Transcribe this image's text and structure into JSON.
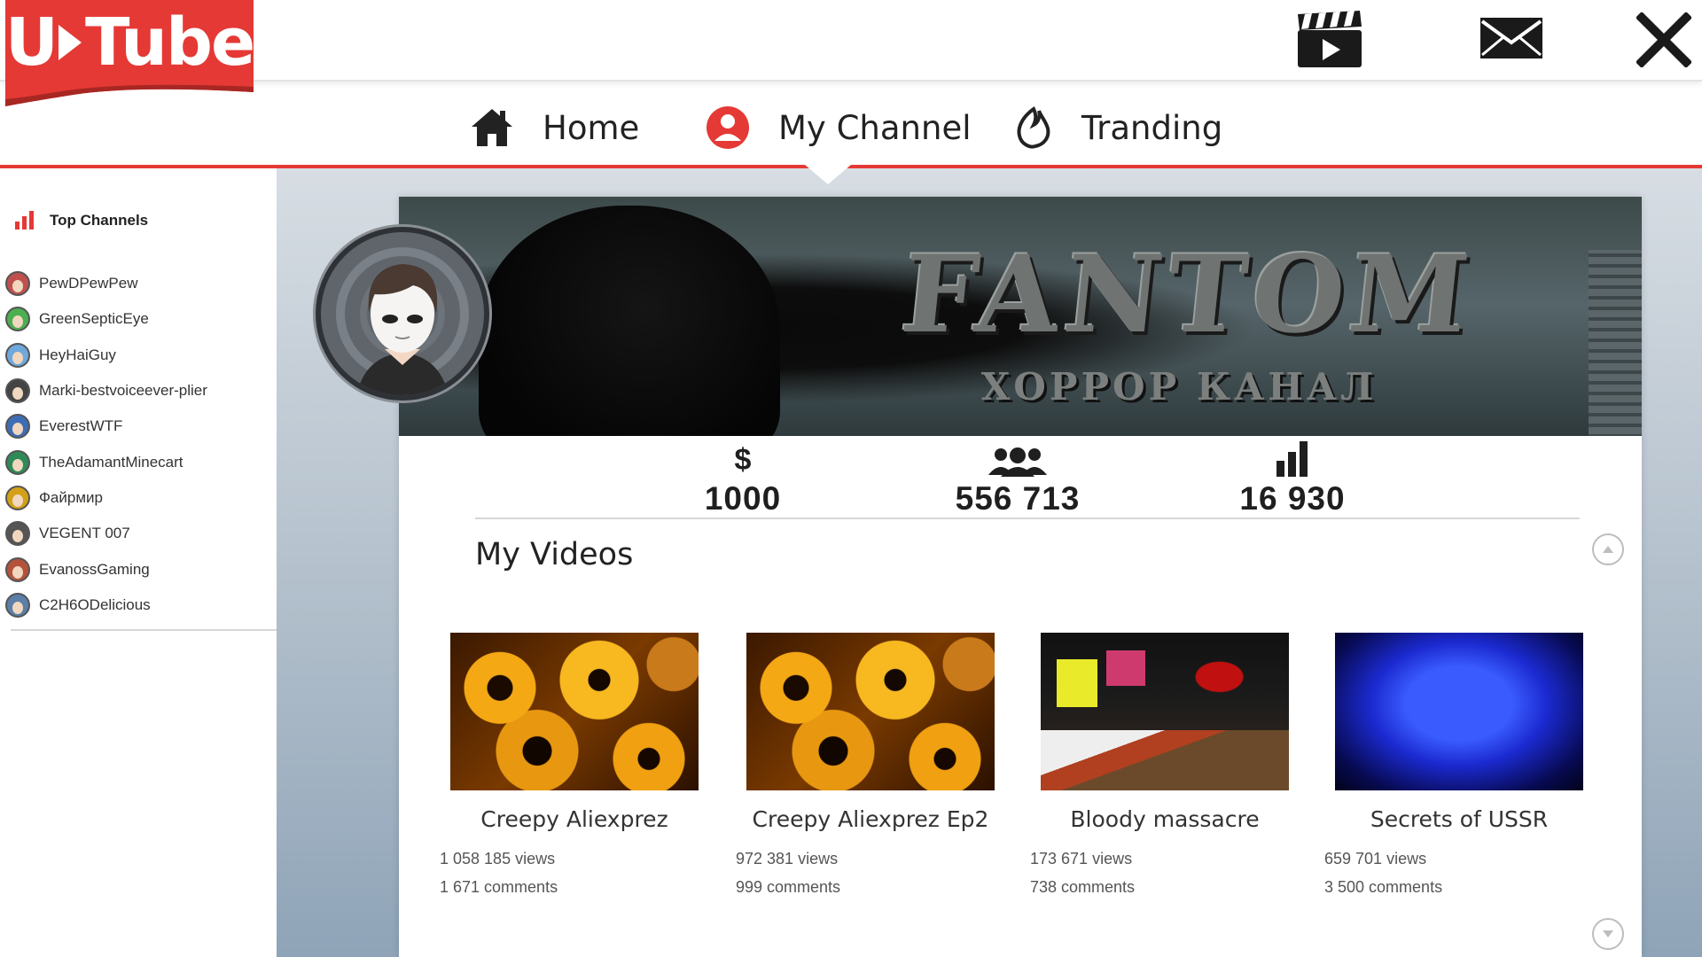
{
  "app": {
    "logo_text": "U Tube",
    "brand_color": "#e53935"
  },
  "top_icons": [
    "clapperboard-icon",
    "mail-icon",
    "close-icon"
  ],
  "nav": {
    "items": [
      {
        "label": "Home",
        "icon": "home-icon"
      },
      {
        "label": "My Channel",
        "icon": "user-icon",
        "active": true
      },
      {
        "label": "Tranding",
        "icon": "flame-icon"
      }
    ]
  },
  "sidebar": {
    "title": "Top Channels",
    "channels": [
      {
        "name": "PewDPewPew",
        "color": "#c0504d"
      },
      {
        "name": "GreenSepticEye",
        "color": "#4caf50"
      },
      {
        "name": "HeyHaiGuy",
        "color": "#6fa8dc"
      },
      {
        "name": "Marki-bestvoiceever-plier",
        "color": "#444444"
      },
      {
        "name": "EverestWTF",
        "color": "#3d6db5"
      },
      {
        "name": "TheAdamantMinecart",
        "color": "#2e8b57"
      },
      {
        "name": "Файрмир",
        "color": "#d4a017"
      },
      {
        "name": "VEGENT 007",
        "color": "#555555"
      },
      {
        "name": "EvanossGaming",
        "color": "#b5523b"
      },
      {
        "name": "C2H6ODelicious",
        "color": "#5a7fa8"
      }
    ]
  },
  "channel": {
    "banner_title": "FANTOM",
    "banner_subtitle": "ХОРРОР КАНАЛ",
    "stats": {
      "money_symbol": "$",
      "money": "1000",
      "subscribers": "556 713",
      "views": "16 930"
    },
    "videos_title": "My Videos",
    "videos": [
      {
        "title": "Creepy Aliexprez",
        "views": "1 058 185 views",
        "comments": "1 671 comments"
      },
      {
        "title": "Creepy Aliexprez Ep2",
        "views": "972 381 views",
        "comments": "999 comments"
      },
      {
        "title": "Bloody massacre",
        "views": "173 671 views",
        "comments": "738 comments"
      },
      {
        "title": "Secrets of USSR",
        "views": "659 701 views",
        "comments": "3 500 comments"
      }
    ]
  }
}
